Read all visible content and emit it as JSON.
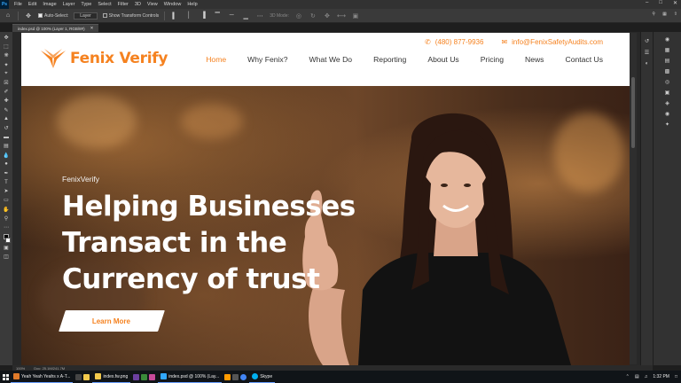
{
  "app": {
    "logo": "Ps",
    "menu": [
      "File",
      "Edit",
      "Image",
      "Layer",
      "Type",
      "Select",
      "Filter",
      "3D",
      "View",
      "Window",
      "Help"
    ],
    "options": {
      "auto_select_label": "Auto-Select:",
      "auto_select_value": "Layer",
      "show_transform_label": "Show Transform Controls",
      "mode_3d": "3D Mode:"
    },
    "document_tab": "index.psd @ 100% (Layer 1, RGB/8#)",
    "status": {
      "zoom": "100%",
      "doc_size": "Doc: 25.1M/241.7M"
    }
  },
  "site": {
    "logo_text": "Fenix Verify",
    "phone": "(480) 877-9936",
    "email": "info@FenixSafetyAudits.com",
    "nav": [
      "Home",
      "Why Fenix?",
      "What We Do",
      "Reporting",
      "About Us",
      "Pricing",
      "News",
      "Contact Us"
    ],
    "active_nav": "Home",
    "hero": {
      "eyebrow": "FenixVerify",
      "headline_lines": [
        "Helping Businesses",
        "Transact in the",
        "Currency of trust"
      ],
      "button": "Learn More"
    },
    "colors": {
      "accent": "#f58220",
      "header_bg": "#ffffff"
    }
  },
  "taskbar": {
    "items": [
      {
        "label": "Yeah Yeah Yeahs x A-T...",
        "color": "#e07a2a"
      },
      {
        "label": "index.fw.png",
        "color": "#f2c94c"
      },
      {
        "label": "index.psd @ 100% (Lay...",
        "color": "#31a8ff"
      },
      {
        "label": "Skype",
        "color": "#00aff0"
      }
    ],
    "time": "1:32 PM"
  }
}
